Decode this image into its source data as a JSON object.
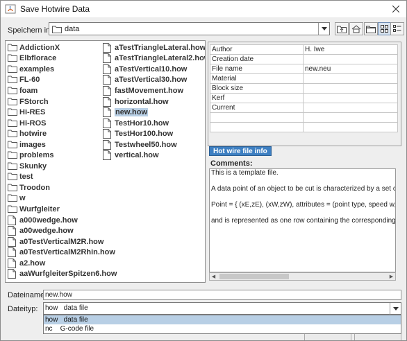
{
  "window": {
    "title": "Save Hotwire Data"
  },
  "lookin": {
    "label": "Speichern in:",
    "value": "data"
  },
  "toolbar": [
    "up-one-level",
    "home",
    "new-folder",
    "list-view",
    "details-view"
  ],
  "files": {
    "col1": [
      {
        "name": "AddictionX",
        "type": "folder"
      },
      {
        "name": "Elbflorace",
        "type": "folder"
      },
      {
        "name": "examples",
        "type": "folder"
      },
      {
        "name": "FL-60",
        "type": "folder"
      },
      {
        "name": "foam",
        "type": "folder"
      },
      {
        "name": "FStorch",
        "type": "folder"
      },
      {
        "name": "Hi-RES",
        "type": "folder"
      },
      {
        "name": "Hi-ROS",
        "type": "folder"
      },
      {
        "name": "hotwire",
        "type": "folder"
      },
      {
        "name": "images",
        "type": "folder"
      },
      {
        "name": "problems",
        "type": "folder"
      },
      {
        "name": "Skunky",
        "type": "folder"
      },
      {
        "name": "test",
        "type": "folder"
      },
      {
        "name": "Troodon",
        "type": "folder"
      },
      {
        "name": "w",
        "type": "folder"
      },
      {
        "name": "Wurfgleiter",
        "type": "folder"
      },
      {
        "name": "a000wedge.how",
        "type": "file"
      },
      {
        "name": "a00wedge.how",
        "type": "file"
      },
      {
        "name": "a0TestVerticalM2R.how",
        "type": "file"
      },
      {
        "name": "a0TestVerticalM2Rhin.how",
        "type": "file"
      },
      {
        "name": "a2.how",
        "type": "file"
      },
      {
        "name": "aaWurfgleiterSpitzen6.how",
        "type": "file"
      }
    ],
    "col2": [
      {
        "name": "aTestTriangleLateral.how",
        "type": "file"
      },
      {
        "name": "aTestTriangleLateral2.how",
        "type": "file"
      },
      {
        "name": "aTestVertical10.how",
        "type": "file"
      },
      {
        "name": "aTestVertical30.how",
        "type": "file"
      },
      {
        "name": "fastMovement.how",
        "type": "file"
      },
      {
        "name": "horizontal.how",
        "type": "file"
      },
      {
        "name": "new.how",
        "type": "file",
        "selected": true
      },
      {
        "name": "TestHor10.how",
        "type": "file"
      },
      {
        "name": "TestHor100.how",
        "type": "file"
      },
      {
        "name": "Testwheel50.how",
        "type": "file"
      },
      {
        "name": "vertical.how",
        "type": "file"
      }
    ]
  },
  "properties": [
    {
      "key": "Author",
      "value": "H. Iwe"
    },
    {
      "key": "Creation date",
      "value": ""
    },
    {
      "key": "File name",
      "value": "new.neu"
    },
    {
      "key": "Material",
      "value": ""
    },
    {
      "key": "Block size",
      "value": ""
    },
    {
      "key": "Kerf",
      "value": ""
    },
    {
      "key": "Current",
      "value": ""
    }
  ],
  "tab": {
    "label": "Hot wire file info"
  },
  "comments": {
    "label": "Comments:",
    "lines": [
      "This is a template file.",
      "",
      "A data point of an object to be cut is characterized by a set of propertie",
      "",
      "Point = { (xE,zE), (xW,zW), attributes = (point type, speed w, comment)",
      "",
      "and is represented as one row containing the corresponding values"
    ]
  },
  "filename": {
    "label": "Dateiname:",
    "value": "new.how"
  },
  "filetype": {
    "label": "Dateityp:",
    "value": "how   data file",
    "options": [
      "how   data file",
      "nc    G-code file"
    ]
  }
}
